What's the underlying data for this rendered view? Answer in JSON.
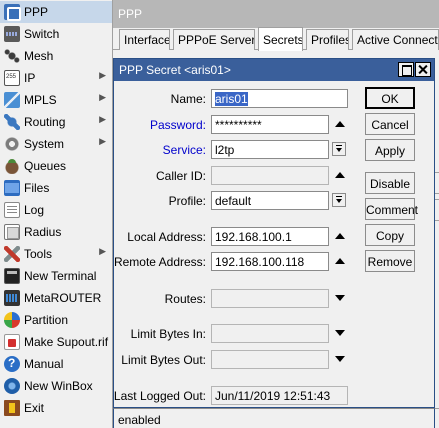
{
  "sidebar": {
    "items": [
      {
        "label": "PPP",
        "icon": "ppp-icon",
        "submenu": false,
        "active": true
      },
      {
        "label": "Switch",
        "icon": "switch-icon",
        "submenu": false
      },
      {
        "label": "Mesh",
        "icon": "mesh-icon",
        "submenu": false
      },
      {
        "label": "IP",
        "icon": "ip-icon",
        "submenu": true
      },
      {
        "label": "MPLS",
        "icon": "mpls-icon",
        "submenu": true
      },
      {
        "label": "Routing",
        "icon": "routing-icon",
        "submenu": true
      },
      {
        "label": "System",
        "icon": "system-icon",
        "submenu": true
      },
      {
        "label": "Queues",
        "icon": "queues-icon",
        "submenu": false
      },
      {
        "label": "Files",
        "icon": "files-icon",
        "submenu": false
      },
      {
        "label": "Log",
        "icon": "log-icon",
        "submenu": false
      },
      {
        "label": "Radius",
        "icon": "radius-icon",
        "submenu": false
      },
      {
        "label": "Tools",
        "icon": "tools-icon",
        "submenu": true
      },
      {
        "label": "New Terminal",
        "icon": "terminal-icon",
        "submenu": false
      },
      {
        "label": "MetaROUTER",
        "icon": "metarouter-icon",
        "submenu": false
      },
      {
        "label": "Partition",
        "icon": "partition-icon",
        "submenu": false
      },
      {
        "label": "Make Supout.rif",
        "icon": "supout-icon",
        "submenu": false
      },
      {
        "label": "Manual",
        "icon": "manual-icon",
        "submenu": false
      },
      {
        "label": "New WinBox",
        "icon": "winbox-icon",
        "submenu": false
      },
      {
        "label": "Exit",
        "icon": "exit-icon",
        "submenu": false
      }
    ]
  },
  "ppp_window": {
    "title": "PPP",
    "tabs": [
      "Interface",
      "PPPoE Servers",
      "Secrets",
      "Profiles",
      "Active Connections"
    ],
    "active_tab": "Secrets"
  },
  "dialog": {
    "title": "PPP Secret <aris01>",
    "fields": {
      "name": {
        "label": "Name:",
        "value": "aris01"
      },
      "password": {
        "label": "Password:",
        "value": "**********"
      },
      "service": {
        "label": "Service:",
        "value": "l2tp"
      },
      "caller_id": {
        "label": "Caller ID:",
        "value": ""
      },
      "profile": {
        "label": "Profile:",
        "value": "default"
      },
      "local_address": {
        "label": "Local Address:",
        "value": "192.168.100.1"
      },
      "remote_address": {
        "label": "Remote Address:",
        "value": "192.168.100.118"
      },
      "routes": {
        "label": "Routes:",
        "value": ""
      },
      "limit_bytes_in": {
        "label": "Limit Bytes In:",
        "value": ""
      },
      "limit_bytes_out": {
        "label": "Limit Bytes Out:",
        "value": ""
      },
      "last_logged_out": {
        "label": "Last Logged Out:",
        "value": "Jun/11/2019 12:51:43"
      }
    },
    "buttons": {
      "ok": "OK",
      "cancel": "Cancel",
      "apply": "Apply",
      "disable": "Disable",
      "comment": "Comment",
      "copy": "Copy",
      "remove": "Remove"
    },
    "status": "enabled"
  },
  "colors": {
    "dialog_titlebar": "#3a5f9b",
    "link_label": "#0000cc",
    "sidebar_active": "#c6d7ea",
    "selection": "#3a66c6"
  }
}
